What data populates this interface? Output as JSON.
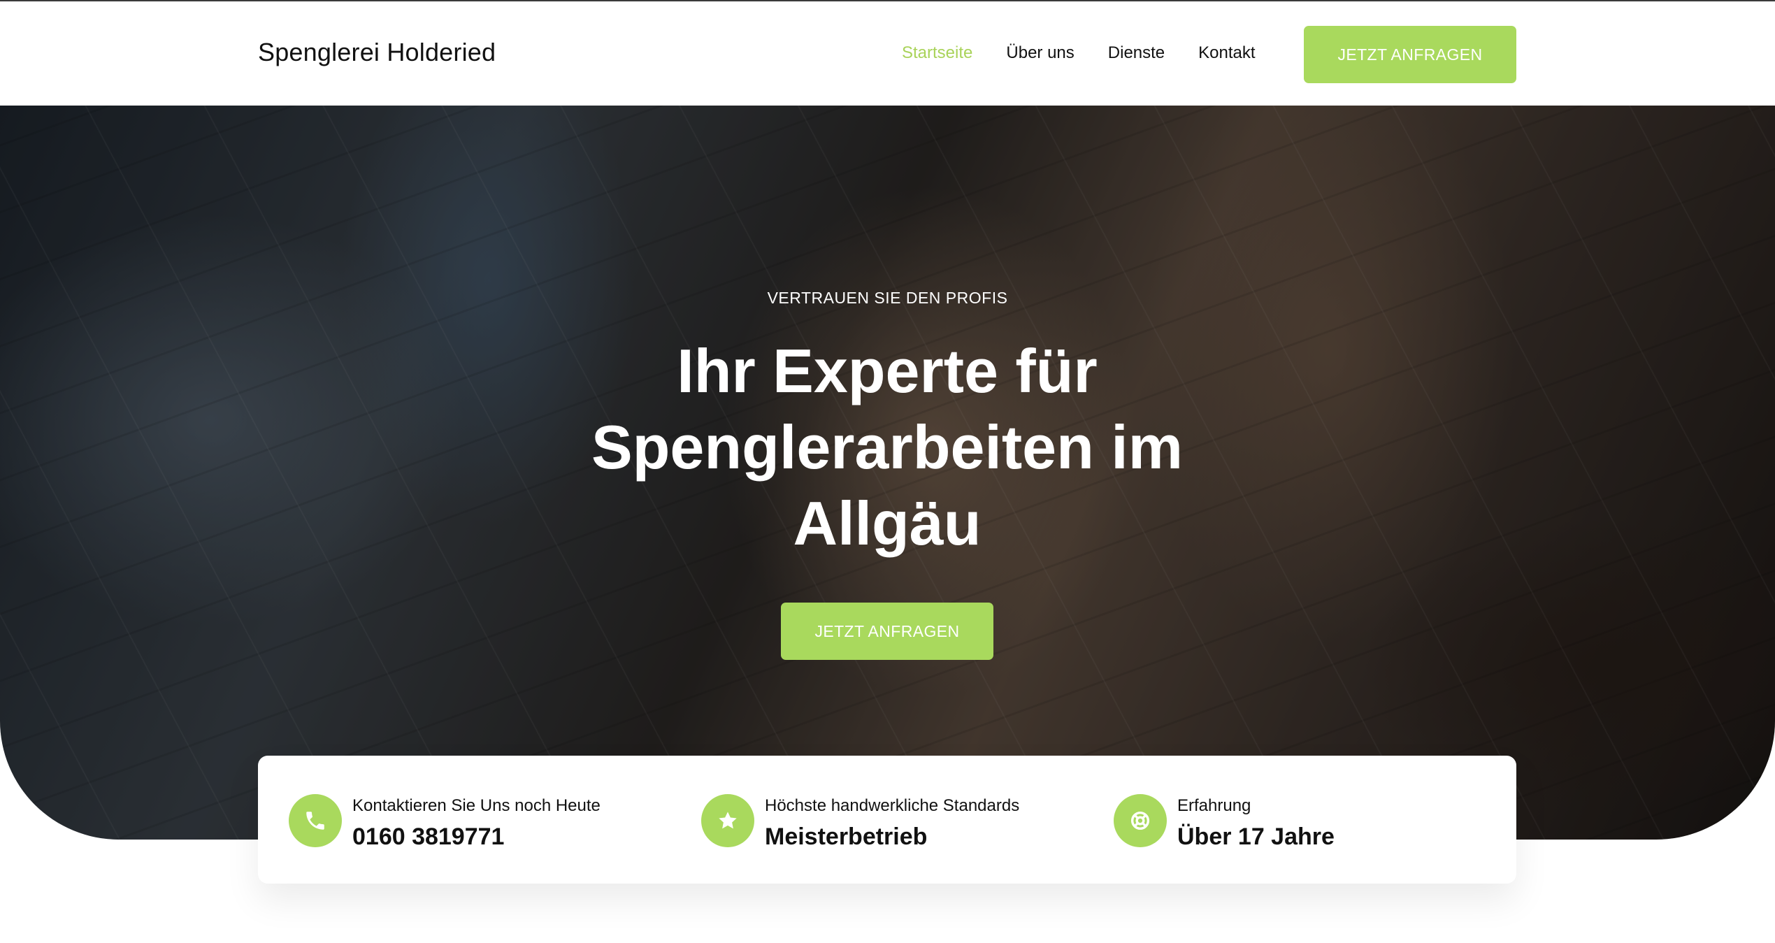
{
  "header": {
    "brand": "Spenglerei Holderied",
    "nav": [
      {
        "label": "Startseite",
        "active": true
      },
      {
        "label": "Über uns",
        "active": false
      },
      {
        "label": "Dienste",
        "active": false
      },
      {
        "label": "Kontakt",
        "active": false
      }
    ],
    "cta_label": "JETZT ANFRAGEN"
  },
  "hero": {
    "eyebrow": "VERTRAUEN SIE DEN PROFIS",
    "headline_lines": [
      "Ihr Experte für",
      "Spenglerarbeiten im",
      "Allgäu"
    ],
    "cta_label": "JETZT ANFRAGEN"
  },
  "info": [
    {
      "icon": "phone-icon",
      "label": "Kontaktieren Sie Uns noch Heute",
      "value": "0160 3819771"
    },
    {
      "icon": "star-icon",
      "label": "Höchste handwerkliche Standards",
      "value": "Meisterbetrieb"
    },
    {
      "icon": "lifebuoy-icon",
      "label": "Erfahrung",
      "value": "Über 17 Jahre"
    }
  ],
  "colors": {
    "accent": "#a9d95d",
    "active_nav": "#a9d35a",
    "text": "#111111"
  }
}
